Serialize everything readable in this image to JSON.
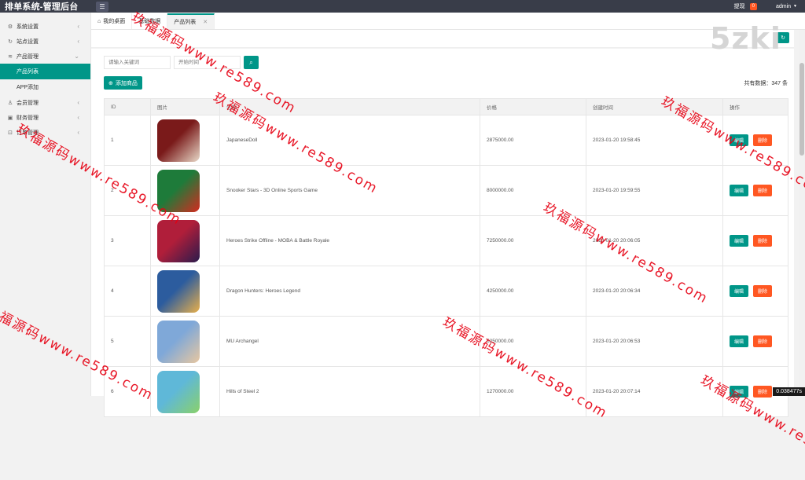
{
  "app": {
    "title": "排单系统-管理后台"
  },
  "topbar": {
    "withdraw_label": "提现",
    "withdraw_badge": "0",
    "user": "admin"
  },
  "sidebar": {
    "items": [
      {
        "label": "系统设置",
        "icon": "gear-icon"
      },
      {
        "label": "站点设置",
        "icon": "refresh-icon"
      },
      {
        "label": "产品管理",
        "icon": "layers-icon"
      }
    ],
    "sub_items": [
      {
        "label": "产品列表"
      },
      {
        "label": "APP添加"
      }
    ],
    "items_after": [
      {
        "label": "会员管理",
        "icon": "user-icon"
      },
      {
        "label": "财务管理",
        "icon": "wallet-icon"
      },
      {
        "label": "订单管理",
        "icon": "cart-icon"
      }
    ]
  },
  "tabs": [
    {
      "label": "我的桌面",
      "icon": "home-icon"
    },
    {
      "label": "基础数据"
    },
    {
      "label": "产品列表",
      "active": true,
      "closable": true
    }
  ],
  "search": {
    "keyword_placeholder": "请输入关键词",
    "date_placeholder": "开始时间"
  },
  "toolbar": {
    "add_label": "添加商品",
    "total_label": "共有数据：347 条"
  },
  "table": {
    "headers": [
      "ID",
      "图片",
      "名称",
      "价格",
      "创建时间",
      "操作"
    ],
    "edit_label": "编辑",
    "delete_label": "删除",
    "rows": [
      {
        "id": "1",
        "name": "JapaneseDoll",
        "price": "2875000.00",
        "created": "2023-01-20 19:58:45",
        "thumb_colors": [
          "#7a1a1a",
          "#e8d9c8"
        ]
      },
      {
        "id": "2",
        "name": "Snooker Stars - 3D Online Sports Game",
        "price": "8000000.00",
        "created": "2023-01-20 19:59:55",
        "thumb_colors": [
          "#1e7b3a",
          "#d42a1f"
        ]
      },
      {
        "id": "3",
        "name": "Heroes Strike Offline - MOBA & Battle Royale",
        "price": "7250000.00",
        "created": "2023-01-20 20:06:05",
        "thumb_colors": [
          "#b01e3a",
          "#2a1b4d"
        ]
      },
      {
        "id": "4",
        "name": "Dragon Hunters: Heroes Legend",
        "price": "4250000.00",
        "created": "2023-01-20 20:06:34",
        "thumb_colors": [
          "#2c5c9e",
          "#e9b04a"
        ]
      },
      {
        "id": "5",
        "name": "MU Archangel",
        "price": "5250000.00",
        "created": "2023-01-20 20:06:53",
        "thumb_colors": [
          "#7fa8d8",
          "#e8c7a0"
        ]
      },
      {
        "id": "6",
        "name": "Hills of Steel 2",
        "price": "1270000.00",
        "created": "2023-01-20 20:07:14",
        "thumb_colors": [
          "#5fb8d8",
          "#8ad16a"
        ]
      }
    ]
  },
  "overlay": {
    "brand": "5zki",
    "watermark": "玖福源码www.re589.com",
    "timer": "0.038477s"
  },
  "colors": {
    "primary": "#009688",
    "danger": "#ff5722",
    "topbar": "#393d49"
  }
}
